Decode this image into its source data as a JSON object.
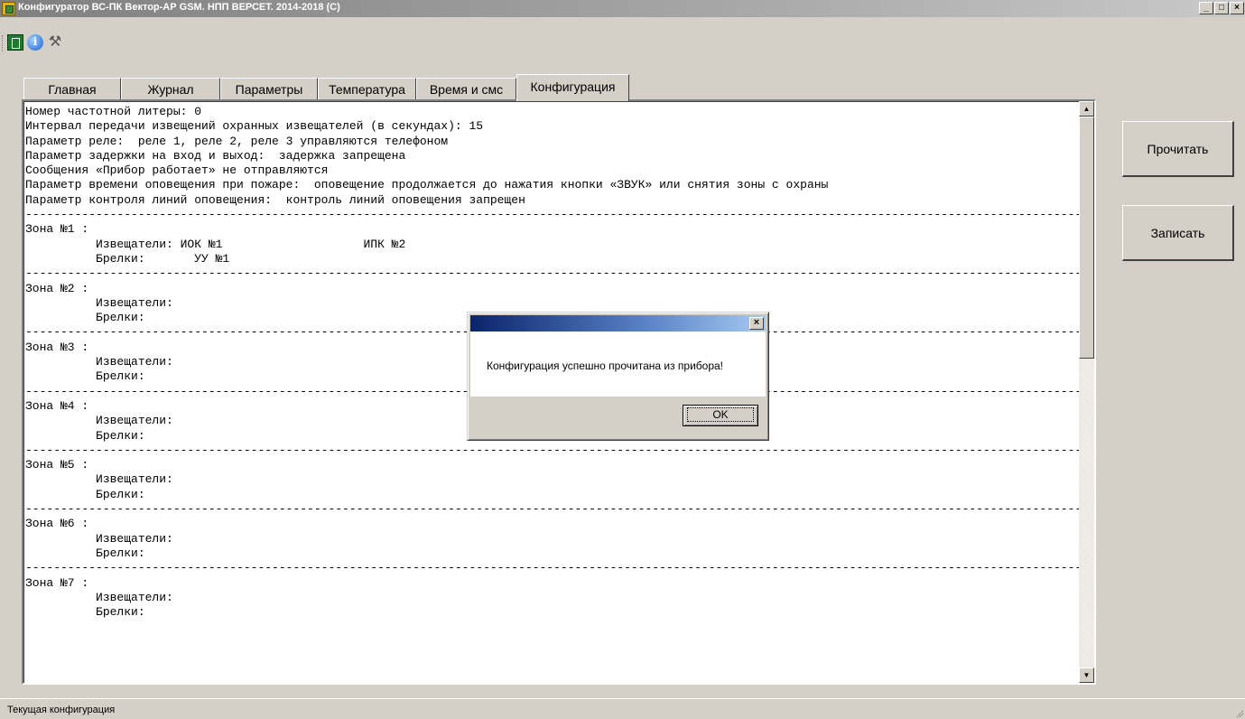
{
  "window": {
    "title": "Конфигуратор ВС-ПК Вектор-АР GSM. НПП ВЕРСЕТ. 2014-2018 (С)",
    "controls": [
      "_",
      "□",
      "×"
    ]
  },
  "toolbar": {
    "icons": [
      "exit-icon",
      "info-icon",
      "tools-icon"
    ]
  },
  "tabs": [
    {
      "label": "Главная"
    },
    {
      "label": "Журнал"
    },
    {
      "label": "Параметры"
    },
    {
      "label": "Температура"
    },
    {
      "label": "Время и смс"
    },
    {
      "label": "Конфигурация",
      "active": true
    }
  ],
  "content": {
    "text": "Номер частотной литеры: 0\nИнтервал передачи извещений охранных извещателей (в секундах): 15\nПараметр реле:  реле 1, реле 2, реле 3 управляются телефоном\nПараметр задержки на вход и выход:  задержка запрещена\nСообщения «Прибор работает» не отправляются\nПараметр времени оповещения при пожаре:  оповещение продолжается до нажатия кнопки «ЗВУК» или снятия зоны с охраны\nПараметр контроля линий оповещения:  контроль линий оповещения запрещен\n------------------------------------------------------------------------------------------------------------------------------------------------------------\nЗона №1 :\n          Извещатели: ИОК №1                    ИПК №2\n          Брелки:       УУ №1\n------------------------------------------------------------------------------------------------------------------------------------------------------------\nЗона №2 :\n          Извещатели:\n          Брелки:\n------------------------------------------------------------------------------------------------------------------------------------------------------------\nЗона №3 :\n          Извещатели:\n          Брелки:\n------------------------------------------------------------------------------------------------------------------------------------------------------------\nЗона №4 :\n          Извещатели:\n          Брелки:\n------------------------------------------------------------------------------------------------------------------------------------------------------------\nЗона №5 :\n          Извещатели:\n          Брелки:\n------------------------------------------------------------------------------------------------------------------------------------------------------------\nЗона №6 :\n          Извещатели:\n          Брелки:\n------------------------------------------------------------------------------------------------------------------------------------------------------------\nЗона №7 :\n          Извещатели:\n          Брелки:"
  },
  "buttons": {
    "read": "Прочитать",
    "write": "Записать"
  },
  "dialog": {
    "message": "Конфигурация успешно прочитана из прибора!",
    "ok": "OK",
    "close": "×"
  },
  "statusbar": {
    "text": "Текущая конфигурация"
  }
}
